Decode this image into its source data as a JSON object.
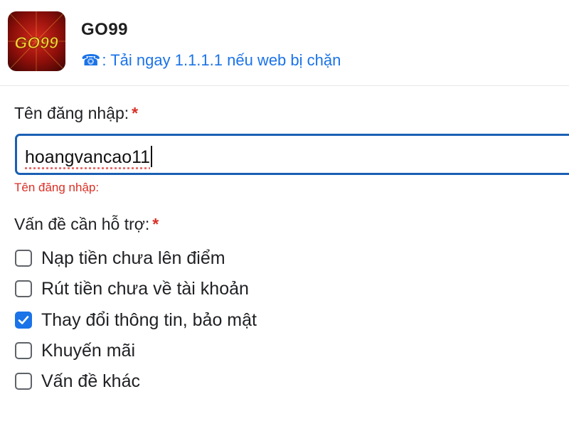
{
  "header": {
    "logo_text": "GO99",
    "app_name": "GO99",
    "notice_icon": "phone-icon",
    "notice_glyph": "☎",
    "notice_text": ": Tải ngay 1.1.1.1 nếu web bị chặn"
  },
  "form": {
    "username": {
      "label": "Tên đăng nhập:",
      "required_mark": "*",
      "value": "hoangvancao11",
      "error": "Tên đăng nhập:"
    },
    "issue": {
      "label": "Vấn đề cần hỗ trợ:",
      "required_mark": "*",
      "options": [
        {
          "label": "Nạp tiền chưa lên điểm",
          "checked": false
        },
        {
          "label": "Rút tiền chưa về tài khoản",
          "checked": false
        },
        {
          "label": "Thay đổi thông tin, bảo mật",
          "checked": true
        },
        {
          "label": "Khuyến mãi",
          "checked": false
        },
        {
          "label": "Vấn đề khác",
          "checked": false
        }
      ]
    }
  },
  "colors": {
    "link_blue": "#1a73e8",
    "input_border": "#1a5fb4",
    "error_red": "#d93025",
    "checkbox_checked": "#1a73e8"
  }
}
